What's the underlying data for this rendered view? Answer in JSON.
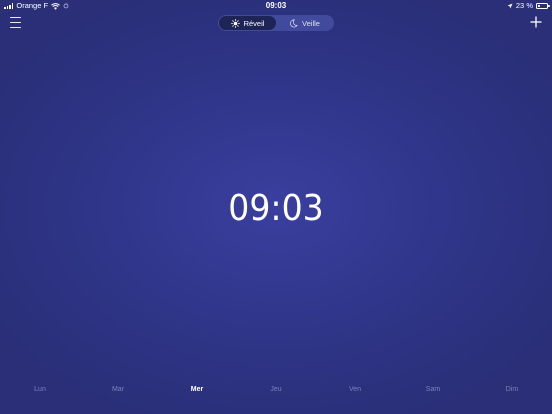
{
  "status_bar": {
    "carrier": "Orange F",
    "time": "09:03",
    "battery_percent": "23 %",
    "battery_level": 0.23
  },
  "header": {
    "segments": [
      {
        "label": "Réveil",
        "icon": "sun-icon",
        "active": true
      },
      {
        "label": "Veille",
        "icon": "moon-icon",
        "active": false
      }
    ]
  },
  "clock": {
    "time": "09:03"
  },
  "days": [
    {
      "label": "Lun",
      "active": false
    },
    {
      "label": "Mar",
      "active": false
    },
    {
      "label": "Mer",
      "active": true
    },
    {
      "label": "Jeu",
      "active": false
    },
    {
      "label": "Ven",
      "active": false
    },
    {
      "label": "Sam",
      "active": false
    },
    {
      "label": "Dim",
      "active": false
    }
  ],
  "colors": {
    "background": "#2f3588",
    "segment_active": "#1f2456",
    "day_inactive": "#7d82b9",
    "day_active": "#ffffff"
  }
}
